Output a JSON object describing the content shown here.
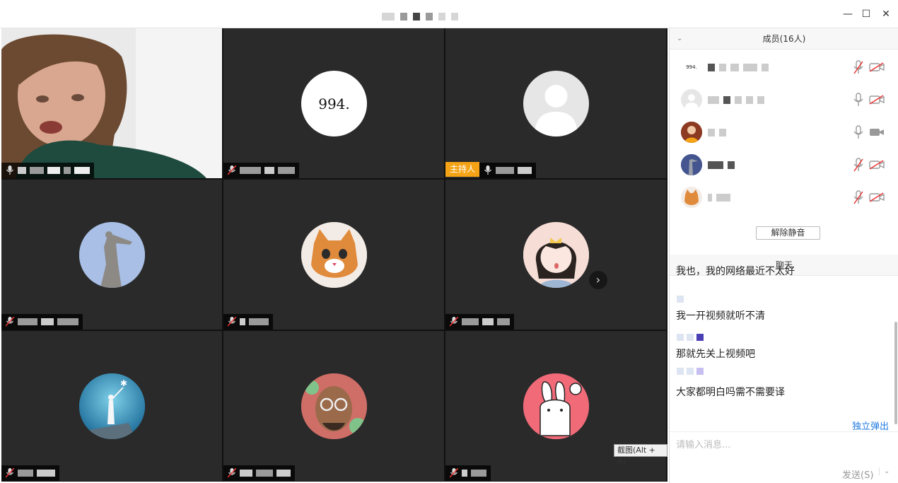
{
  "window": {
    "controls": {
      "minimize": "—",
      "maximize": "☐",
      "close": "✕"
    }
  },
  "grid": {
    "host_badge": "主持人",
    "avatar_994_text": "994.",
    "next_page_icon": "chevron-right-icon",
    "screenshot_tooltip": "截图(Alt + A)"
  },
  "members": {
    "header": "成员(16人)",
    "avatar_994_text": "994.",
    "unmute_all": "解除静音"
  },
  "chat": {
    "header": "聊天",
    "messages": [
      "我也，我的网络最近不太好",
      "我一开视频就听不清",
      "那就先关上视频吧",
      "大家都明白吗需不需要译"
    ],
    "popout": "独立弹出",
    "input_placeholder": "请输入消息...",
    "send": "发送(S)",
    "send_menu_icon": "chevron-down-icon"
  }
}
